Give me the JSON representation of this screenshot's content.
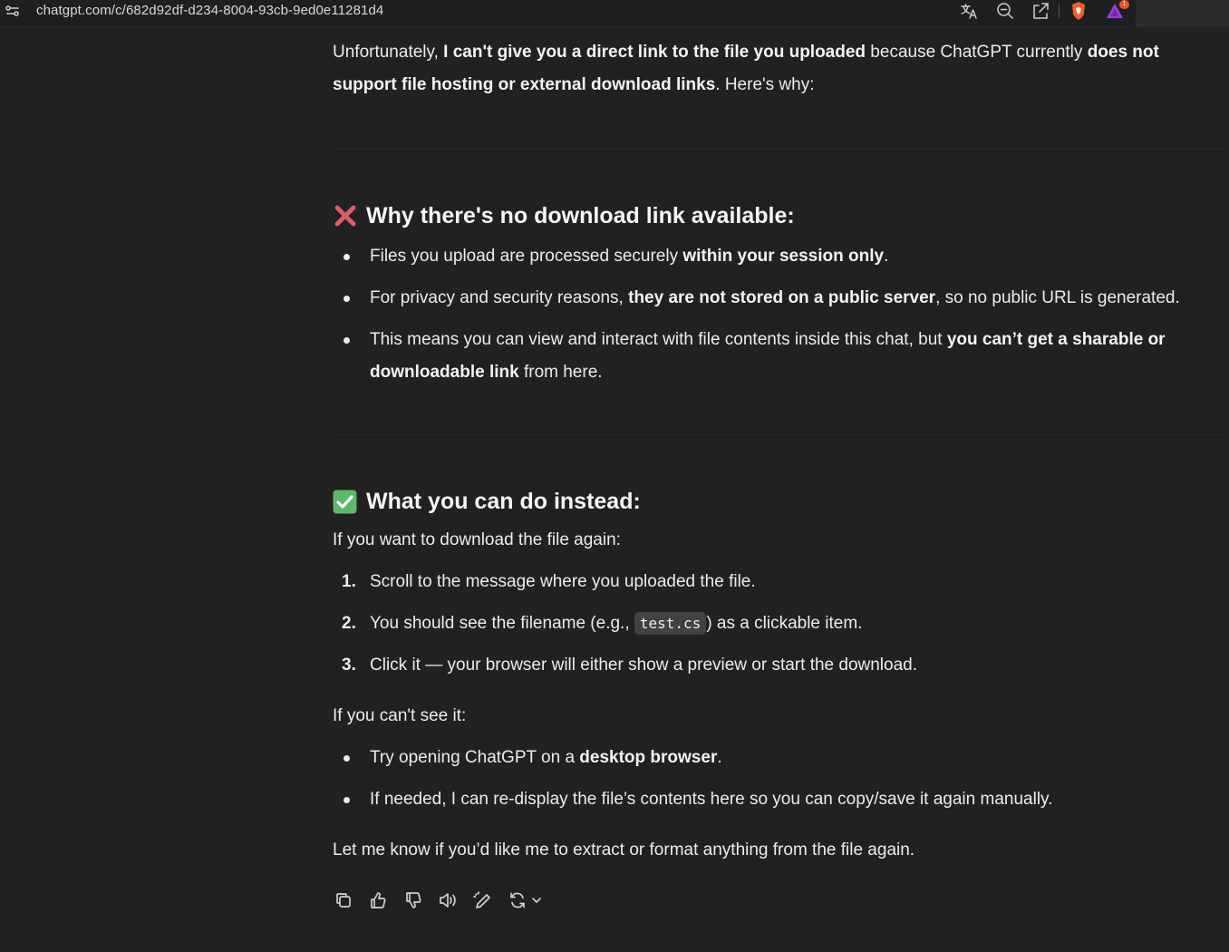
{
  "browser": {
    "url": "chatgpt.com/c/682d92df-d234-8004-93cb-9ed0e11281d4",
    "notification_count": "1",
    "icons": [
      "site-settings-icon",
      "translate-icon",
      "zoom-out-icon",
      "share-icon",
      "brave-shield-icon",
      "brave-rewards-icon"
    ]
  },
  "message": {
    "intro": {
      "t1": "Unfortunately, ",
      "b1": "I can't give you a direct link to the file you uploaded",
      "t2": " because ChatGPT currently ",
      "b2": "does not support file hosting or external download links",
      "t3": ". Here's why:"
    },
    "section1": {
      "emoji": "cross-mark",
      "heading": "Why there's no download link available:",
      "bullets": [
        {
          "t1": "Files you upload are processed securely ",
          "b1": "within your session only",
          "t2": "."
        },
        {
          "t1": "For privacy and security reasons, ",
          "b1": "they are not stored on a public server",
          "t2": ", so no public URL is generated."
        },
        {
          "t1": "This means you can view and interact with file contents inside this chat, but ",
          "b1": "you can’t get a sharable or downloadable link",
          "t2": " from here."
        }
      ]
    },
    "section2": {
      "emoji": "check-mark-button",
      "heading": "What you can do instead:",
      "lead": "If you want to download the file again:",
      "steps": [
        {
          "num": "1.",
          "text": "Scroll to the message where you uploaded the file."
        },
        {
          "num": "2.",
          "t1": "You should see the filename (e.g., ",
          "code": "test.cs",
          "t2": ") as a clickable item."
        },
        {
          "num": "3.",
          "text": "Click it — your browser will either show a preview or start the download."
        }
      ],
      "lead2": "If you can't see it:",
      "bullets": [
        {
          "t1": "Try opening ChatGPT on a ",
          "b1": "desktop browser",
          "t2": "."
        },
        {
          "text": "If needed, I can re-display the file’s contents here so you can copy/save it again manually."
        }
      ],
      "closing": "Let me know if you’d like me to extract or format anything from the file again."
    }
  },
  "actions": [
    "copy-icon",
    "thumbs-up-icon",
    "thumbs-down-icon",
    "read-aloud-icon",
    "edit-icon",
    "regenerate-icon",
    "chevron-down-icon"
  ],
  "colors": {
    "background": "#212121",
    "text": "#ececec",
    "cross": "#e05a6a",
    "check": "#5fb86a"
  }
}
